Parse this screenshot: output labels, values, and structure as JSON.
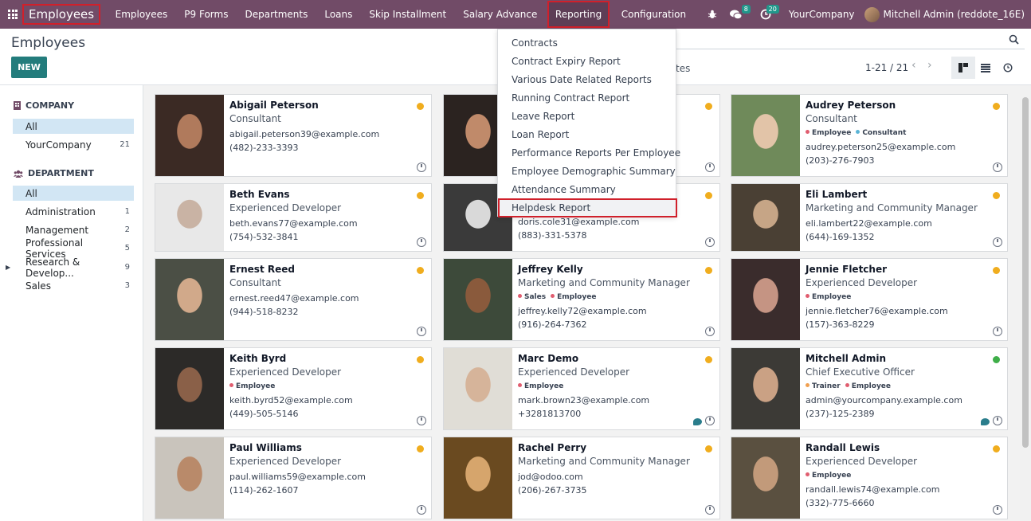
{
  "navbar": {
    "app_name": "Employees",
    "menu": [
      "Employees",
      "P9 Forms",
      "Departments",
      "Loans",
      "Skip Installment",
      "Salary Advance",
      "Reporting",
      "Configuration"
    ],
    "active_menu": "Reporting",
    "chat_badge": "8",
    "activity_badge": "20",
    "company": "YourCompany",
    "user": "Mitchell Admin (reddote_16E)"
  },
  "control": {
    "title": "Employees",
    "new_label": "NEW",
    "partial_text": "tes",
    "pager": "1-21 / 21"
  },
  "sidebar": {
    "company_heading": "COMPANY",
    "company_items": [
      {
        "label": "All",
        "count": ""
      },
      {
        "label": "YourCompany",
        "count": "21"
      }
    ],
    "department_heading": "DEPARTMENT",
    "department_items": [
      {
        "label": "All",
        "count": ""
      },
      {
        "label": "Administration",
        "count": "1"
      },
      {
        "label": "Management",
        "count": "2"
      },
      {
        "label": "Professional Services",
        "count": "5"
      },
      {
        "label": "Research & Develop...",
        "count": "9"
      },
      {
        "label": "Sales",
        "count": "3"
      }
    ]
  },
  "reporting_menu": [
    "Contracts",
    "Contract Expiry Report",
    "Various Date Related Reports",
    "Running Contract Report",
    "Leave Report",
    "Loan Report",
    "Performance Reports Per Employee",
    "Employee Demographic Summary",
    "Attendance Summary",
    "Helpdesk Report"
  ],
  "employees": [
    {
      "name": "Abigail Peterson",
      "job": "Consultant",
      "tags": [],
      "email": "abigail.peterson39@example.com",
      "phone": "(482)-233-3393",
      "status": "away"
    },
    {
      "name": "",
      "job": "",
      "tags": [],
      "email": "",
      "phone": "",
      "status": "away"
    },
    {
      "name": "Audrey Peterson",
      "job": "Consultant",
      "tags": [
        "Employee",
        "Consultant"
      ],
      "email": "audrey.peterson25@example.com",
      "phone": "(203)-276-7903",
      "status": "away"
    },
    {
      "name": "Beth Evans",
      "job": "Experienced Developer",
      "tags": [],
      "email": "beth.evans77@example.com",
      "phone": "(754)-532-3841",
      "status": "away"
    },
    {
      "name": "",
      "job": "",
      "tags": [],
      "email": "doris.cole31@example.com",
      "phone": "(883)-331-5378",
      "status": "away"
    },
    {
      "name": "Eli Lambert",
      "job": "Marketing and Community Manager",
      "tags": [],
      "email": "eli.lambert22@example.com",
      "phone": "(644)-169-1352",
      "status": "away"
    },
    {
      "name": "Ernest Reed",
      "job": "Consultant",
      "tags": [],
      "email": "ernest.reed47@example.com",
      "phone": "(944)-518-8232",
      "status": "away"
    },
    {
      "name": "Jeffrey Kelly",
      "job": "Marketing and Community Manager",
      "tags": [
        "Sales",
        "Employee"
      ],
      "email": "jeffrey.kelly72@example.com",
      "phone": "(916)-264-7362",
      "status": "away"
    },
    {
      "name": "Jennie Fletcher",
      "job": "Experienced Developer",
      "tags": [
        "Employee"
      ],
      "email": "jennie.fletcher76@example.com",
      "phone": "(157)-363-8229",
      "status": "away"
    },
    {
      "name": "Keith Byrd",
      "job": "Experienced Developer",
      "tags": [
        "Employee"
      ],
      "email": "keith.byrd52@example.com",
      "phone": "(449)-505-5146",
      "status": "away"
    },
    {
      "name": "Marc Demo",
      "job": "Experienced Developer",
      "tags": [
        "Employee"
      ],
      "email": "mark.brown23@example.com",
      "phone": "+3281813700",
      "status": "away"
    },
    {
      "name": "Mitchell Admin",
      "job": "Chief Executive Officer",
      "tags": [
        "Trainer",
        "Employee"
      ],
      "email": "admin@yourcompany.example.com",
      "phone": "(237)-125-2389",
      "status": "online"
    },
    {
      "name": "Paul Williams",
      "job": "Experienced Developer",
      "tags": [],
      "email": "paul.williams59@example.com",
      "phone": "(114)-262-1607",
      "status": "away"
    },
    {
      "name": "Rachel Perry",
      "job": "Marketing and Community Manager",
      "tags": [],
      "email": "jod@odoo.com",
      "phone": "(206)-267-3735",
      "status": "away"
    },
    {
      "name": "Randall Lewis",
      "job": "Experienced Developer",
      "tags": [
        "Employee"
      ],
      "email": "randall.lewis74@example.com",
      "phone": "(332)-775-6660",
      "status": "away"
    }
  ],
  "tag_colors": {
    "Employee": "#e05d6f",
    "Consultant": "#5ab4d6",
    "Sales": "#e05d6f",
    "Trainer": "#f0a050"
  },
  "status_colors": {
    "away": "#f0ad1e",
    "online": "#3fae49"
  },
  "colors": {
    "brand": "#714b67",
    "accent": "#237c7c"
  }
}
